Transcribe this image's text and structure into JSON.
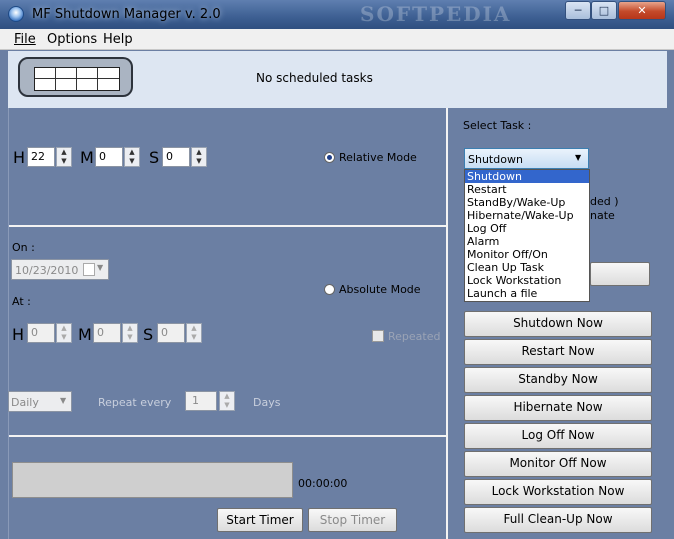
{
  "window": {
    "title": "MF Shutdown Manager v. 2.0",
    "watermark": "SOFTPEDIA",
    "controls": {
      "minimize": "─",
      "maximize": "□",
      "close": "✕"
    }
  },
  "menu": [
    "File",
    "Options",
    "Help"
  ],
  "header": {
    "status": "No scheduled tasks",
    "icon": "computer-panel-icon"
  },
  "relative": {
    "h_label": "H",
    "m_label": "M",
    "s_label": "S",
    "h": "22",
    "m": "0",
    "s": "0",
    "mode_label": "Relative Mode"
  },
  "absolute": {
    "on_label": "On :",
    "date": "10/23/2010",
    "at_label": "At :",
    "h": "0",
    "m": "0",
    "s": "0",
    "mode_label": "Absolute Mode",
    "repeated_label": "Repeated"
  },
  "repeat": {
    "frequency": "Daily",
    "every_label": "Repeat every",
    "count": "1",
    "unit": "Days"
  },
  "timer": {
    "time": "00:00:00",
    "progress_fraction": 0,
    "start_label": "Start Timer",
    "stop_label": "Stop Timer"
  },
  "task": {
    "label": "Select Task :",
    "selected": "Shutdown",
    "options": [
      "Shutdown",
      "Restart",
      "StandBy/Wake-Up",
      "Hibernate/Wake-Up",
      "Log Off",
      "Alarm",
      "Monitor Off/On",
      "Clean Up Task",
      "Lock Workstation",
      "Launch a file"
    ],
    "hidden_text_1": "ded )",
    "hidden_text_2": "nate"
  },
  "actions": [
    "Shutdown Now",
    "Restart Now",
    "Standby Now",
    "Hibernate Now",
    "Log Off Now",
    "Monitor Off Now",
    "Lock Workstation Now",
    "Full Clean-Up Now"
  ],
  "colors": {
    "panel": "#6b7fa3",
    "header": "#dde6f2",
    "selection": "#3366cc"
  }
}
